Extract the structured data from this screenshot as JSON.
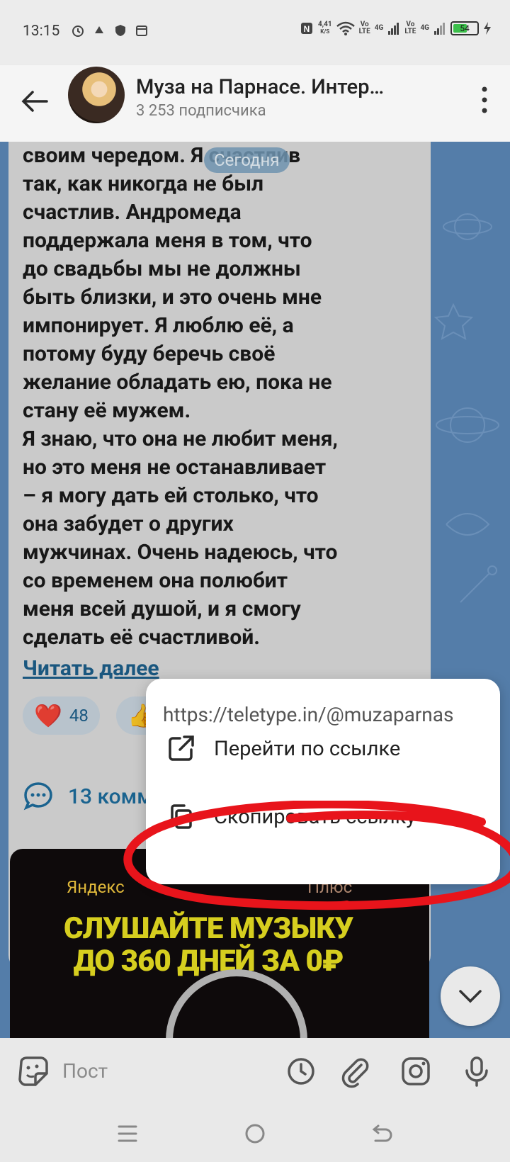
{
  "status_bar": {
    "time": "13:15",
    "net_speed": "4,41",
    "net_unit": "K/S",
    "sim1": "Vo\nLTE",
    "sim1_net": "4G",
    "sim2": "Vo\nLTE",
    "sim2_net": "4G",
    "battery": "54",
    "battery_level": 0.54
  },
  "header": {
    "title": "Муза на Парнасе. Интер…",
    "subtitle": "3 253 подписчика"
  },
  "post": {
    "date_badge": "Сегодня",
    "text": "своим чередом. Я счастлив\nтак, как никогда не был\nсчастлив. Андромеда\nподдержала меня в том, что\nдо свадьбы мы не должны\nбыть близки, и это очень мне\nимпонирует. Я люблю её, а\nпотому буду беречь своё\nжелание обладать ею, пока не\nстану её мужем.\nЯ знаю, что она не любит меня,\nно это меня не останавливает\n– я могу дать ей столько, что\nона забудет о других\nмужчинах. Очень надеюсь, что\nсо временем она полюбит\nменя всей душой, и я смогу\nсделать её счастливой.",
    "read_more": "Читать далее",
    "reactions": [
      {
        "emoji": "❤️",
        "count": "48"
      },
      {
        "emoji": "👍",
        "count": ""
      }
    ],
    "comments_label": "13 комм"
  },
  "ad": {
    "brand": "Яндекс",
    "brand_suffix": "Плюс",
    "headline": "СЛУШАЙТЕ МУЗЫКУ\nДО 360 ДНЕЙ ЗА 0₽"
  },
  "popup": {
    "url": "https://teletype.in/@muzaparnas",
    "items": [
      {
        "label": "Перейти по ссылке",
        "icon": "open-external-icon"
      },
      {
        "label": "Скопировать ссылку",
        "icon": "copy-icon"
      }
    ]
  },
  "input_bar": {
    "placeholder": "Пост",
    "icons": [
      "sticker-icon",
      "clock-icon",
      "paperclip-icon",
      "instagram-icon",
      "microphone-icon"
    ]
  },
  "colors": {
    "accent": "#1d6c9c",
    "annotation": "#e8141b",
    "chat_bg": "#5c88b8"
  }
}
